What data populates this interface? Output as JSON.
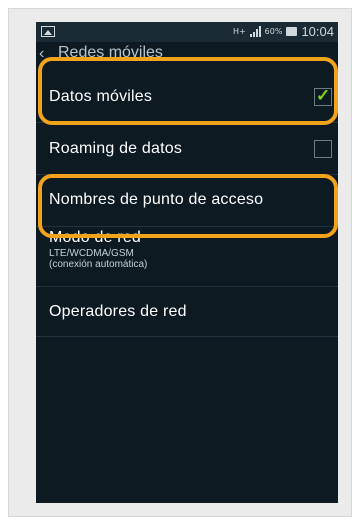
{
  "status_bar": {
    "network": "H+",
    "battery_percent": "60%",
    "time": "10:04"
  },
  "header": {
    "title": "Redes móviles",
    "back_icon": "back-arrow-icon"
  },
  "settings": {
    "items": [
      {
        "label": "Datos móviles",
        "checked": true
      },
      {
        "label": "Roaming de datos",
        "checked": false
      },
      {
        "label": "Nombres de punto de acceso"
      },
      {
        "label": "Modo de red",
        "subtitle_line1": "LTE/WCDMA/GSM",
        "subtitle_line2": "(conexión automática)"
      },
      {
        "label": "Operadores de red"
      }
    ]
  },
  "colors": {
    "highlight": "#f2a31c",
    "check_accent": "#7cd31f",
    "background": "#0d1a22"
  }
}
